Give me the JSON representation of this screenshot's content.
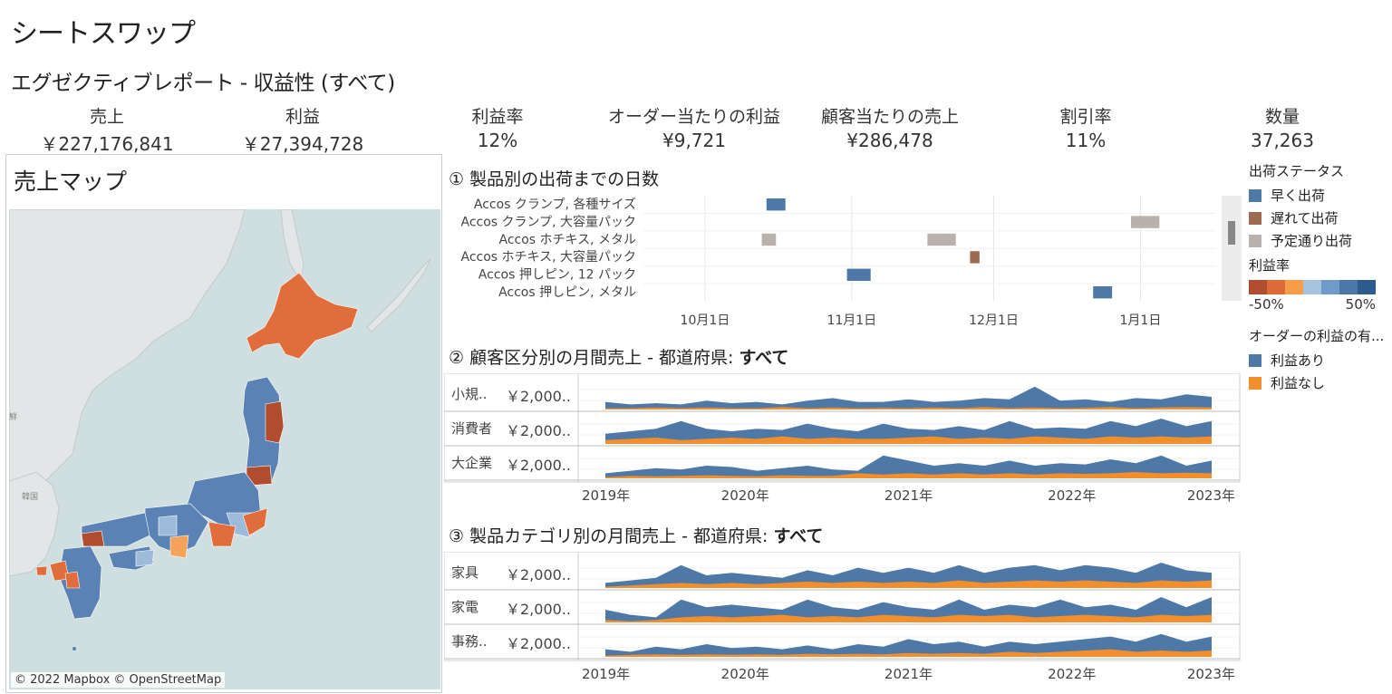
{
  "page": {
    "title": "シートスワップ",
    "subtitle": "エグゼクティブレポート - 収益性 (すべて)"
  },
  "kpis": [
    {
      "label": "売上",
      "value": "￥227,176,841"
    },
    {
      "label": "利益",
      "value": "￥27,394,728"
    },
    {
      "label": "利益率",
      "value": "12%"
    },
    {
      "label": "オーダー当たりの利益",
      "value": "¥9,721"
    },
    {
      "label": "顧客当たりの売上",
      "value": "¥286,478"
    },
    {
      "label": "割引率",
      "value": "11%"
    },
    {
      "label": "数量",
      "value": "37,263"
    }
  ],
  "map": {
    "title": "売上マップ",
    "attribution": "© 2022 Mapbox © OpenStreetMap",
    "labels": {
      "korea": "韓国",
      "korea_north": "鮮"
    },
    "colors": {
      "sea": "#cfdede",
      "land": "#e3e6e6",
      "loss_dark": "#b04d2e",
      "loss": "#e06d3b",
      "loss_light": "#f5a25b",
      "profit": "#5a82b4",
      "profit_light": "#9cbbdb"
    }
  },
  "shipping": {
    "title": "①  製品別の出荷までの日数",
    "rows": [
      "Accos クランプ, 各種サイズ",
      "Accos クランプ, 大容量パック",
      "Accos ホチキス, メタル",
      "Accos ホチキス, 大容量パック",
      "Accos 押しピン, 12 パック",
      "Accos 押しピン, メタル"
    ],
    "axis_ticks": [
      "10月1日",
      "11月1日",
      "12月1日",
      "1月1日"
    ],
    "chart_data": {
      "type": "gantt",
      "x_axis": "date",
      "tasks": [
        {
          "row": 0,
          "start": "2022-10-14",
          "end": "2022-10-18",
          "status": "early"
        },
        {
          "row": 1,
          "start": "2022-12-30",
          "end": "2023-01-05",
          "status": "scheduled"
        },
        {
          "row": 2,
          "start": "2022-10-13",
          "end": "2022-10-16",
          "status": "scheduled"
        },
        {
          "row": 2,
          "start": "2022-11-17",
          "end": "2022-11-23",
          "status": "scheduled"
        },
        {
          "row": 3,
          "start": "2022-11-26",
          "end": "2022-11-28",
          "status": "late"
        },
        {
          "row": 4,
          "start": "2022-10-31",
          "end": "2022-11-05",
          "status": "early"
        },
        {
          "row": 5,
          "start": "2022-12-22",
          "end": "2022-12-26",
          "status": "early"
        }
      ]
    }
  },
  "legend_ship": {
    "title": "出荷ステータス",
    "items": [
      {
        "label": "早く出荷",
        "color": "#4e79a7"
      },
      {
        "label": "遅れて出荷",
        "color": "#9c6b51"
      },
      {
        "label": "予定通り出荷",
        "color": "#bab0ac"
      }
    ]
  },
  "legend_margin": {
    "title": "利益率",
    "min_label": "-50%",
    "max_label": "50%",
    "colors": [
      "#b04d2e",
      "#dd6b36",
      "#f79d4a",
      "#a4c3e0",
      "#6f9bc8",
      "#4b76a8",
      "#2c5b8e"
    ]
  },
  "legend_profit": {
    "title": "オーダーの利益の有...",
    "items": [
      {
        "label": "利益あり",
        "color": "#4e79a7"
      },
      {
        "label": "利益なし",
        "color": "#f28e2b"
      }
    ]
  },
  "segment": {
    "title_prefix": "②  顧客区分別の月間売上 - 都道府県: ",
    "title_bold": "すべて",
    "rows": [
      {
        "label": "小規..",
        "value": "￥2,000.."
      },
      {
        "label": "消費者",
        "value": "￥2,000.."
      },
      {
        "label": "大企業",
        "value": "￥2,000.."
      }
    ],
    "axis_ticks": [
      "2019年",
      "2020年",
      "2021年",
      "2022年",
      "2023年"
    ],
    "chart_data": {
      "type": "area",
      "x": [
        "2019-01",
        "2019-03",
        "2019-05",
        "2019-07",
        "2019-09",
        "2019-11",
        "2020-01",
        "2020-03",
        "2020-05",
        "2020-07",
        "2020-09",
        "2020-11",
        "2021-01",
        "2021-03",
        "2021-05",
        "2021-07",
        "2021-09",
        "2021-11",
        "2022-01",
        "2022-03",
        "2022-05",
        "2022-07",
        "2022-09",
        "2022-11",
        "2023-01"
      ],
      "series": [
        {
          "name": "小規..",
          "profit": [
            0.3,
            0.2,
            0.25,
            0.2,
            0.35,
            0.25,
            0.3,
            0.2,
            0.35,
            0.45,
            0.3,
            0.3,
            0.4,
            0.3,
            0.35,
            0.45,
            0.4,
            0.9,
            0.35,
            0.4,
            0.3,
            0.45,
            0.4,
            0.6,
            0.5
          ],
          "loss": [
            0.05,
            0.05,
            0.08,
            0.05,
            0.08,
            0.05,
            0.05,
            0.1,
            0.05,
            0.08,
            0.05,
            0.06,
            0.05,
            0.08,
            0.05,
            0.1,
            0.05,
            0.08,
            0.05,
            0.06,
            0.1,
            0.05,
            0.08,
            0.1,
            0.08
          ]
        },
        {
          "name": "消費者",
          "profit": [
            0.4,
            0.5,
            0.6,
            0.9,
            0.6,
            0.5,
            0.6,
            0.55,
            0.8,
            0.6,
            0.5,
            0.8,
            0.6,
            0.55,
            0.7,
            0.55,
            0.9,
            0.6,
            0.65,
            0.6,
            0.9,
            0.7,
            1.0,
            0.7,
            0.9
          ],
          "loss": [
            0.15,
            0.2,
            0.25,
            0.15,
            0.2,
            0.25,
            0.2,
            0.3,
            0.2,
            0.25,
            0.2,
            0.2,
            0.25,
            0.3,
            0.2,
            0.25,
            0.2,
            0.3,
            0.25,
            0.2,
            0.3,
            0.25,
            0.3,
            0.25,
            0.3
          ]
        },
        {
          "name": "大企業",
          "profit": [
            0.2,
            0.3,
            0.4,
            0.35,
            0.5,
            0.45,
            0.3,
            0.4,
            0.5,
            0.35,
            0.3,
            0.9,
            0.7,
            0.5,
            0.6,
            0.5,
            0.7,
            0.5,
            0.6,
            0.55,
            0.75,
            0.6,
            0.9,
            0.5,
            0.7
          ],
          "loss": [
            0.05,
            0.1,
            0.08,
            0.1,
            0.12,
            0.1,
            0.08,
            0.12,
            0.1,
            0.1,
            0.2,
            0.15,
            0.2,
            0.15,
            0.2,
            0.15,
            0.2,
            0.15,
            0.2,
            0.18,
            0.2,
            0.25,
            0.2,
            0.22,
            0.2
          ]
        }
      ]
    }
  },
  "category": {
    "title_prefix": "③  製品カテゴリ別の月間売上 - 都道府県: ",
    "title_bold": "すべて",
    "rows": [
      {
        "label": "家具",
        "value": "￥2,000.."
      },
      {
        "label": "家電",
        "value": "￥2,000.."
      },
      {
        "label": "事務..",
        "value": "￥2,000.."
      }
    ],
    "axis_ticks": [
      "2019年",
      "2020年",
      "2021年",
      "2022年",
      "2023年"
    ],
    "chart_data": {
      "type": "area",
      "x": [
        "2019-01",
        "2019-03",
        "2019-05",
        "2019-07",
        "2019-09",
        "2019-11",
        "2020-01",
        "2020-03",
        "2020-05",
        "2020-07",
        "2020-09",
        "2020-11",
        "2021-01",
        "2021-03",
        "2021-05",
        "2021-07",
        "2021-09",
        "2021-11",
        "2022-01",
        "2022-03",
        "2022-05",
        "2022-07",
        "2022-09",
        "2022-11",
        "2023-01"
      ],
      "series": [
        {
          "name": "家具",
          "profit": [
            0.2,
            0.3,
            0.4,
            0.9,
            0.5,
            0.6,
            0.5,
            0.4,
            0.7,
            0.5,
            0.8,
            0.6,
            0.8,
            0.6,
            0.9,
            0.6,
            0.8,
            0.9,
            0.7,
            0.9,
            0.8,
            0.6,
            1.0,
            0.7,
            0.6
          ],
          "loss": [
            0.05,
            0.1,
            0.15,
            0.2,
            0.15,
            0.2,
            0.15,
            0.2,
            0.25,
            0.2,
            0.25,
            0.2,
            0.25,
            0.2,
            0.3,
            0.2,
            0.25,
            0.3,
            0.25,
            0.3,
            0.25,
            0.2,
            0.3,
            0.25,
            0.3
          ]
        },
        {
          "name": "家電",
          "profit": [
            0.5,
            0.3,
            0.2,
            0.9,
            0.6,
            0.7,
            0.6,
            0.5,
            0.9,
            0.6,
            0.5,
            0.8,
            0.6,
            0.5,
            0.9,
            0.5,
            0.7,
            0.6,
            0.9,
            0.6,
            0.7,
            0.5,
            1.0,
            0.6,
            1.0
          ],
          "loss": [
            0.1,
            0.05,
            0.1,
            0.2,
            0.25,
            0.2,
            0.25,
            0.3,
            0.2,
            0.25,
            0.2,
            0.3,
            0.25,
            0.2,
            0.3,
            0.25,
            0.3,
            0.2,
            0.25,
            0.3,
            0.25,
            0.2,
            0.3,
            0.25,
            0.3
          ]
        },
        {
          "name": "事務..",
          "profit": [
            0.3,
            0.2,
            0.4,
            0.3,
            0.5,
            0.35,
            0.4,
            0.3,
            0.45,
            0.3,
            0.5,
            0.4,
            0.7,
            0.5,
            0.6,
            0.4,
            0.6,
            0.5,
            0.6,
            0.7,
            0.8,
            0.6,
            0.9,
            0.6,
            0.8
          ],
          "loss": [
            0.05,
            0.08,
            0.1,
            0.08,
            0.1,
            0.08,
            0.1,
            0.08,
            0.12,
            0.1,
            0.12,
            0.1,
            0.15,
            0.12,
            0.15,
            0.12,
            0.2,
            0.15,
            0.2,
            0.25,
            0.3,
            0.2,
            0.25,
            0.2,
            0.25
          ]
        }
      ]
    }
  }
}
